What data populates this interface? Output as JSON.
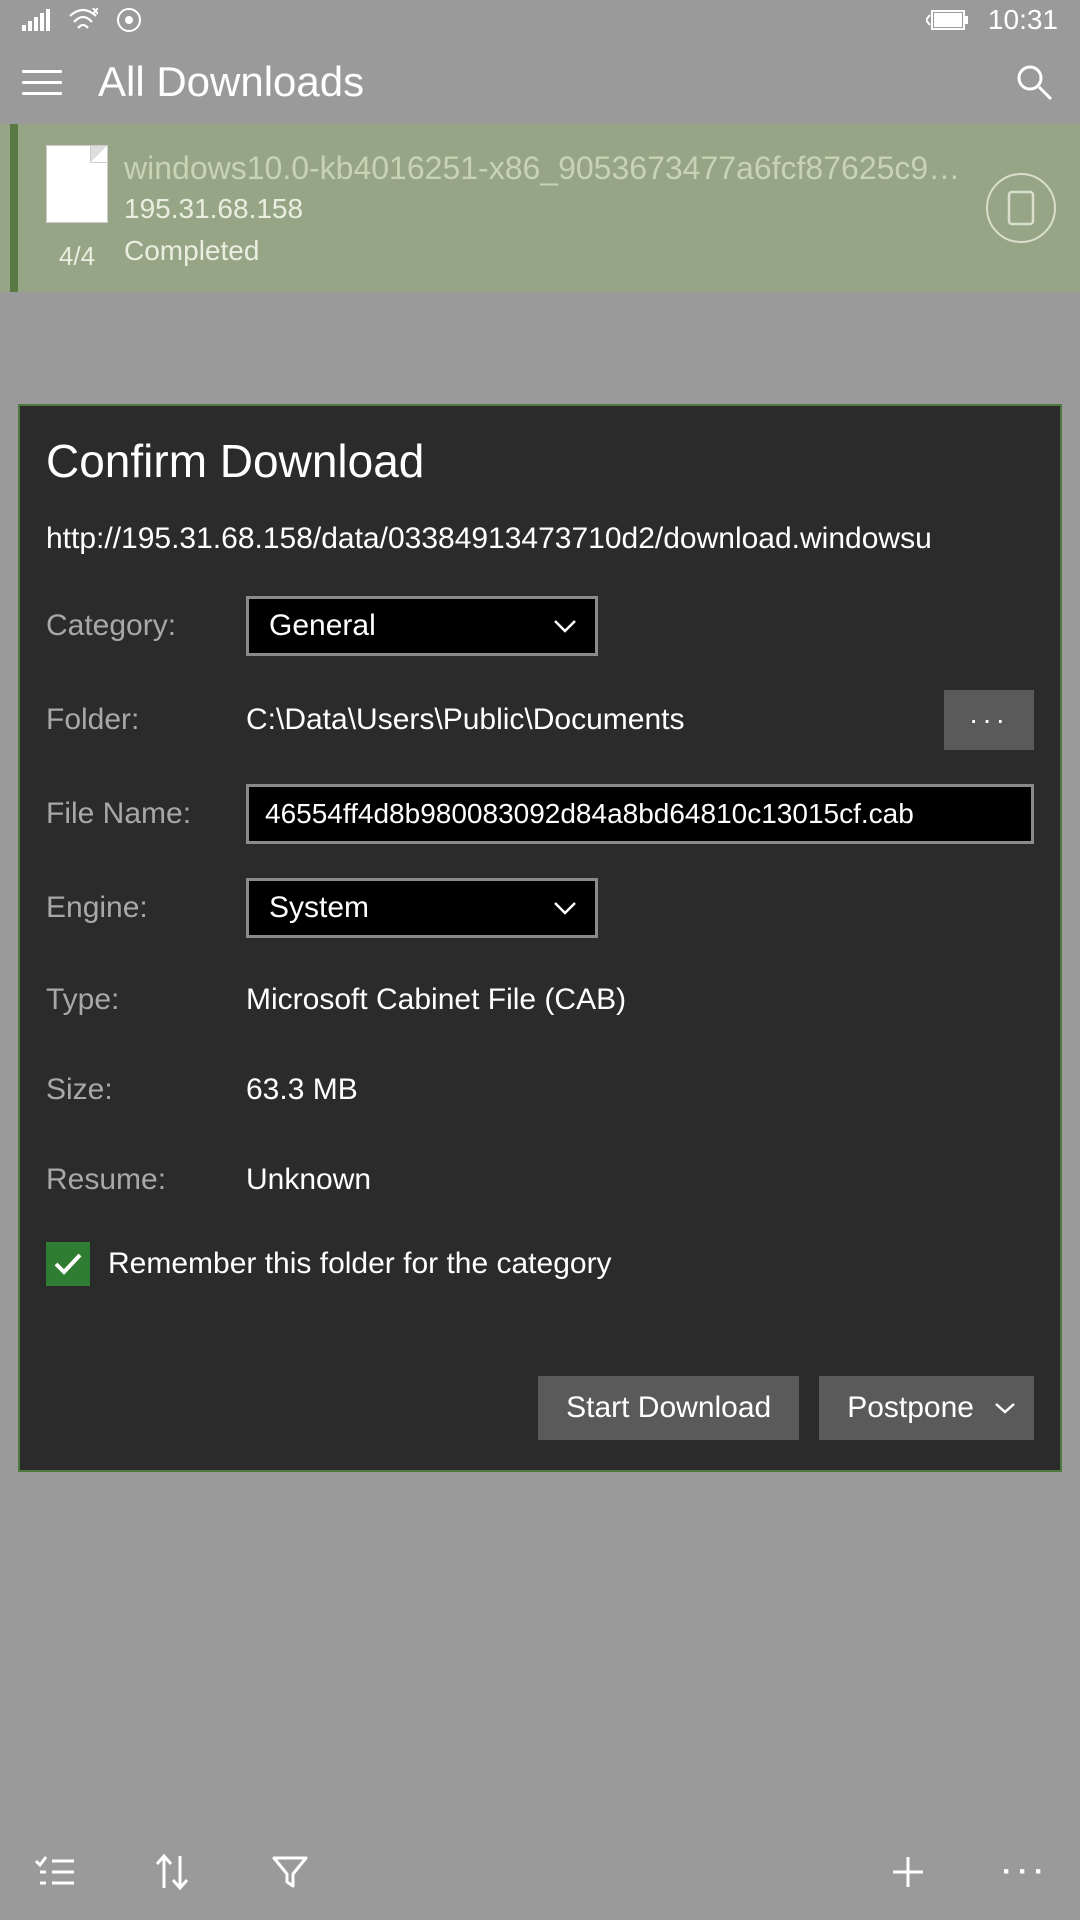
{
  "status": {
    "time": "10:31"
  },
  "header": {
    "title": "All Downloads"
  },
  "item": {
    "filename": "windows10.0-kb4016251-x86_9053673477a6fcf87625c95...",
    "host": "195.31.68.158",
    "count": "4/4",
    "status": "Completed"
  },
  "dialog": {
    "title": "Confirm Download",
    "url": "http://195.31.68.158/data/03384913473710d2/download.windowsu",
    "labels": {
      "category": "Category:",
      "folder": "Folder:",
      "filename": "File Name:",
      "engine": "Engine:",
      "type": "Type:",
      "size": "Size:",
      "resume": "Resume:"
    },
    "category_value": "General",
    "folder_value": "C:\\Data\\Users\\Public\\Documents",
    "more": "···",
    "filename_value": "46554ff4d8b980083092d84a8bd64810c13015cf.cab",
    "engine_value": "System",
    "type_value": "Microsoft Cabinet File (CAB)",
    "size_value": "63.3 MB",
    "resume_value": "Unknown",
    "remember_label": "Remember this folder for the category",
    "start_label": "Start Download",
    "postpone_label": "Postpone"
  }
}
